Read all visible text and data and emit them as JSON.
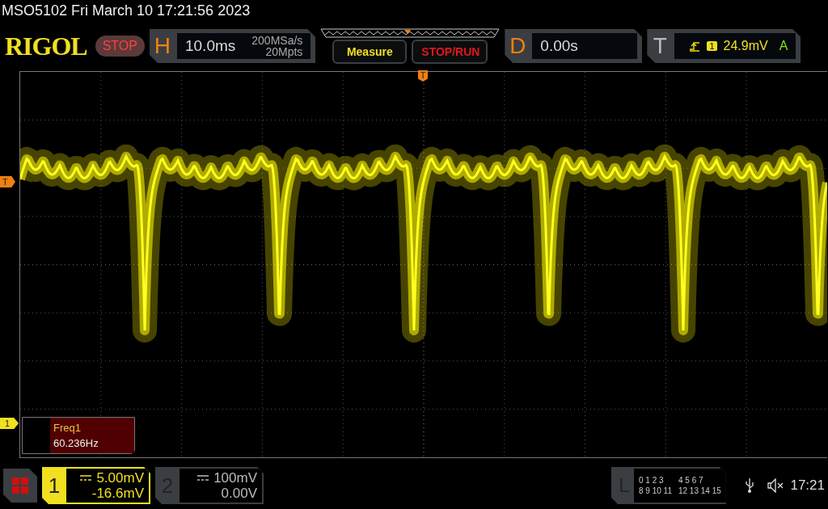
{
  "status_bar": {
    "title": "MSO5102  Fri March 10 17:21:56 2023"
  },
  "header": {
    "logo": "RIGOL",
    "run_state": "STOP",
    "horizontal": {
      "label": "H",
      "timebase": "10.0ms",
      "sample_rate": "200MSa/s",
      "memory_depth": "20Mpts"
    },
    "buttons": [
      "Measure",
      "STOP/RUN"
    ],
    "delay": {
      "label": "D",
      "value": "0.00s"
    },
    "trigger": {
      "label": "T",
      "source": "1",
      "level": "24.9mV",
      "mode": "A"
    }
  },
  "screen": {
    "trigger_position_marker": "T",
    "trigger_level_marker": "T",
    "channel_marker": "1",
    "measurement": {
      "name": "Freq1",
      "value": "60.236Hz"
    }
  },
  "channels": [
    {
      "number": "1",
      "scale": "5.00mV",
      "offset": "-16.6mV",
      "active": true
    },
    {
      "number": "2",
      "scale": "100mV",
      "offset": "0.00V",
      "active": false
    }
  ],
  "logic": {
    "label": "L",
    "groups": [
      "0 1 2 3",
      "4 5 6 7",
      "8 9 10 11",
      "12 13 14 15"
    ]
  },
  "clock": "17:21"
}
